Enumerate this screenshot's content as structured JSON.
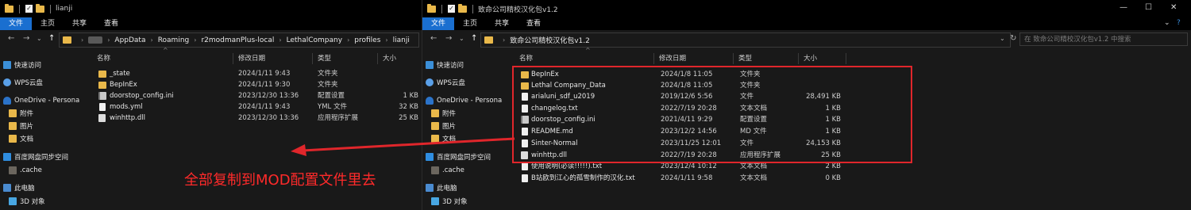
{
  "left_window": {
    "title": "lianji",
    "ribbon_tabs": [
      "文件",
      "主页",
      "共享",
      "查看"
    ],
    "breadcrumb": [
      "AppData",
      "Roaming",
      "r2modmanPlus-local",
      "LethalCompany",
      "profiles",
      "lianji"
    ],
    "columns": [
      "名称",
      "修改日期",
      "类型",
      "大小"
    ],
    "files": [
      {
        "name": "_state",
        "date": "2024/1/11 9:43",
        "type": "文件夹",
        "size": "",
        "icon": "folder-icon"
      },
      {
        "name": "BepInEx",
        "date": "2024/1/11 9:30",
        "type": "文件夹",
        "size": "",
        "icon": "folder-icon"
      },
      {
        "name": "doorstop_config.ini",
        "date": "2023/12/30 13:36",
        "type": "配置设置",
        "size": "1 KB",
        "icon": "config-file-icon"
      },
      {
        "name": "mods.yml",
        "date": "2024/1/11 9:43",
        "type": "YML 文件",
        "size": "32 KB",
        "icon": "file-icon"
      },
      {
        "name": "winhttp.dll",
        "date": "2023/12/30 13:36",
        "type": "应用程序扩展",
        "size": "25 KB",
        "icon": "dll-file-icon"
      }
    ]
  },
  "right_window": {
    "title": "致命公司精校汉化包v1.2",
    "ribbon_tabs": [
      "文件",
      "主页",
      "共享",
      "查看"
    ],
    "breadcrumb": [
      "致命公司精校汉化包v1.2"
    ],
    "search_placeholder": "在 致命公司精校汉化包v1.2 中搜索",
    "columns": [
      "名称",
      "修改日期",
      "类型",
      "大小"
    ],
    "files": [
      {
        "name": "BepInEx",
        "date": "2024/1/8 11:05",
        "type": "文件夹",
        "size": "",
        "icon": "folder-icon"
      },
      {
        "name": "Lethal Company_Data",
        "date": "2024/1/8 11:05",
        "type": "文件夹",
        "size": "",
        "icon": "folder-icon"
      },
      {
        "name": "arialuni_sdf_u2019",
        "date": "2019/12/6 5:56",
        "type": "文件",
        "size": "28,491 KB",
        "icon": "file-icon"
      },
      {
        "name": "changelog.txt",
        "date": "2022/7/19 20:28",
        "type": "文本文档",
        "size": "1 KB",
        "icon": "file-icon"
      },
      {
        "name": "doorstop_config.ini",
        "date": "2021/4/11 9:29",
        "type": "配置设置",
        "size": "1 KB",
        "icon": "config-file-icon"
      },
      {
        "name": "README.md",
        "date": "2023/12/2 14:56",
        "type": "MD 文件",
        "size": "1 KB",
        "icon": "file-icon"
      },
      {
        "name": "Sinter-Normal",
        "date": "2023/11/25 12:01",
        "type": "文件",
        "size": "24,153 KB",
        "icon": "file-icon"
      },
      {
        "name": "winhttp.dll",
        "date": "2022/7/19 20:28",
        "type": "应用程序扩展",
        "size": "25 KB",
        "icon": "dll-file-icon"
      },
      {
        "name": "使用说明(必读!!!!!).txt",
        "date": "2023/12/4 10:12",
        "type": "文本文档",
        "size": "2 KB",
        "icon": "file-icon"
      },
      {
        "name": "B站欧到江心的孤雪制作的汉化.txt",
        "date": "2024/1/11 9:58",
        "type": "文本文档",
        "size": "0 KB",
        "icon": "file-icon"
      }
    ]
  },
  "nav_pane": [
    {
      "label": "快速访问",
      "icon": "star-icon",
      "section": true
    },
    {
      "label": "WPS云盘",
      "icon": "cloud-icon",
      "section": true
    },
    {
      "label": "OneDrive - Persona",
      "icon": "onedrive-icon",
      "section": true
    },
    {
      "label": "附件",
      "icon": "folder-icon",
      "section": false
    },
    {
      "label": "图片",
      "icon": "folder-icon",
      "section": false
    },
    {
      "label": "文档",
      "icon": "folder-icon",
      "section": false
    },
    {
      "label": "百度网盘同步空间",
      "icon": "drive-icon",
      "section": true
    },
    {
      "label": ".cache",
      "icon": "folder-icon",
      "section": false
    },
    {
      "label": "此电脑",
      "icon": "pc-icon",
      "section": true
    },
    {
      "label": "3D 对象",
      "icon": "3d-objects-icon",
      "section": false
    }
  ],
  "annotation": {
    "text": "全部复制到MOD配置文件里去",
    "color": "#ff2a2a"
  },
  "colors": {
    "ribbon_active": "#1a6fd0",
    "highlight_box": "#e0262b",
    "folder": "#e9b84a"
  }
}
